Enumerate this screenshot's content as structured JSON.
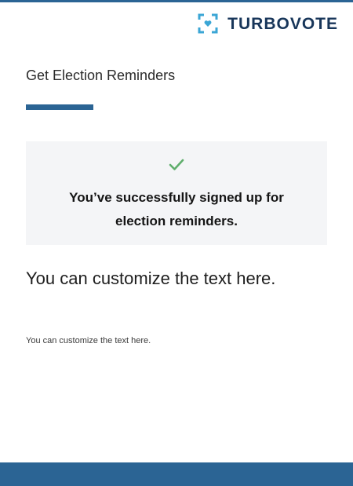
{
  "brand": {
    "name": "TURBOVOTE",
    "colors": {
      "primary": "#2b6494",
      "logo_text": "#18365a",
      "logo_icon": "#3ba6d5",
      "success": "#5fae6c",
      "panel_bg": "#f4f5f7"
    },
    "logo_icon": "turbovote-ballot-heart-icon"
  },
  "page": {
    "title": "Get Election Reminders"
  },
  "success": {
    "icon": "check-icon",
    "message": "You’ve successfully signed up for election reminders."
  },
  "content": {
    "lead_text": "You can customize the text here.",
    "small_text": "You can customize the text here."
  }
}
